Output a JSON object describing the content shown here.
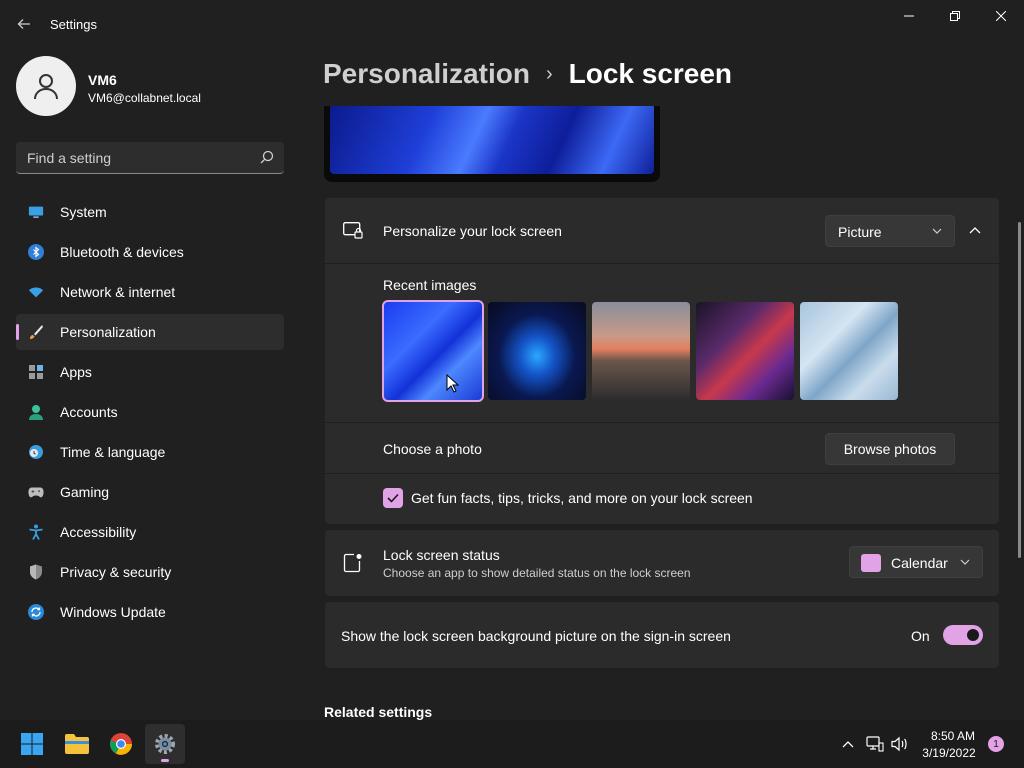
{
  "app": {
    "title": "Settings"
  },
  "user": {
    "name": "VM6",
    "email": "VM6@collabnet.local"
  },
  "search": {
    "placeholder": "Find a setting"
  },
  "sidebar": {
    "items": [
      {
        "label": "System",
        "icon": "monitor-icon",
        "active": false
      },
      {
        "label": "Bluetooth & devices",
        "icon": "bluetooth-icon",
        "active": false
      },
      {
        "label": "Network & internet",
        "icon": "wifi-icon",
        "active": false
      },
      {
        "label": "Personalization",
        "icon": "paintbrush-icon",
        "active": true
      },
      {
        "label": "Apps",
        "icon": "apps-icon",
        "active": false
      },
      {
        "label": "Accounts",
        "icon": "person-icon",
        "active": false
      },
      {
        "label": "Time & language",
        "icon": "globe-clock-icon",
        "active": false
      },
      {
        "label": "Gaming",
        "icon": "gamepad-icon",
        "active": false
      },
      {
        "label": "Accessibility",
        "icon": "accessibility-icon",
        "active": false
      },
      {
        "label": "Privacy & security",
        "icon": "shield-icon",
        "active": false
      },
      {
        "label": "Windows Update",
        "icon": "update-icon",
        "active": false
      }
    ]
  },
  "breadcrumb": {
    "parent": "Personalization",
    "separator": "›",
    "current": "Lock screen"
  },
  "personalize": {
    "label": "Personalize your lock screen",
    "dropdown_value": "Picture",
    "recent_label": "Recent images",
    "choose_photo_label": "Choose a photo",
    "browse_button": "Browse photos",
    "fun_facts_label": "Get fun facts, tips, tricks, and more on your lock screen",
    "fun_facts_checked": true
  },
  "status": {
    "label": "Lock screen status",
    "sublabel": "Choose an app to show detailed status on the lock screen",
    "dropdown_value": "Calendar"
  },
  "signin": {
    "label": "Show the lock screen background picture on the sign-in screen",
    "toggle_label": "On",
    "toggle_on": true
  },
  "related": {
    "heading": "Related settings"
  },
  "taskbar": {
    "time": "8:50 AM",
    "date": "3/19/2022",
    "notification_count": "1"
  },
  "colors": {
    "accent": "#e1a2e6",
    "background": "#202020",
    "card": "#2b2b2b"
  }
}
